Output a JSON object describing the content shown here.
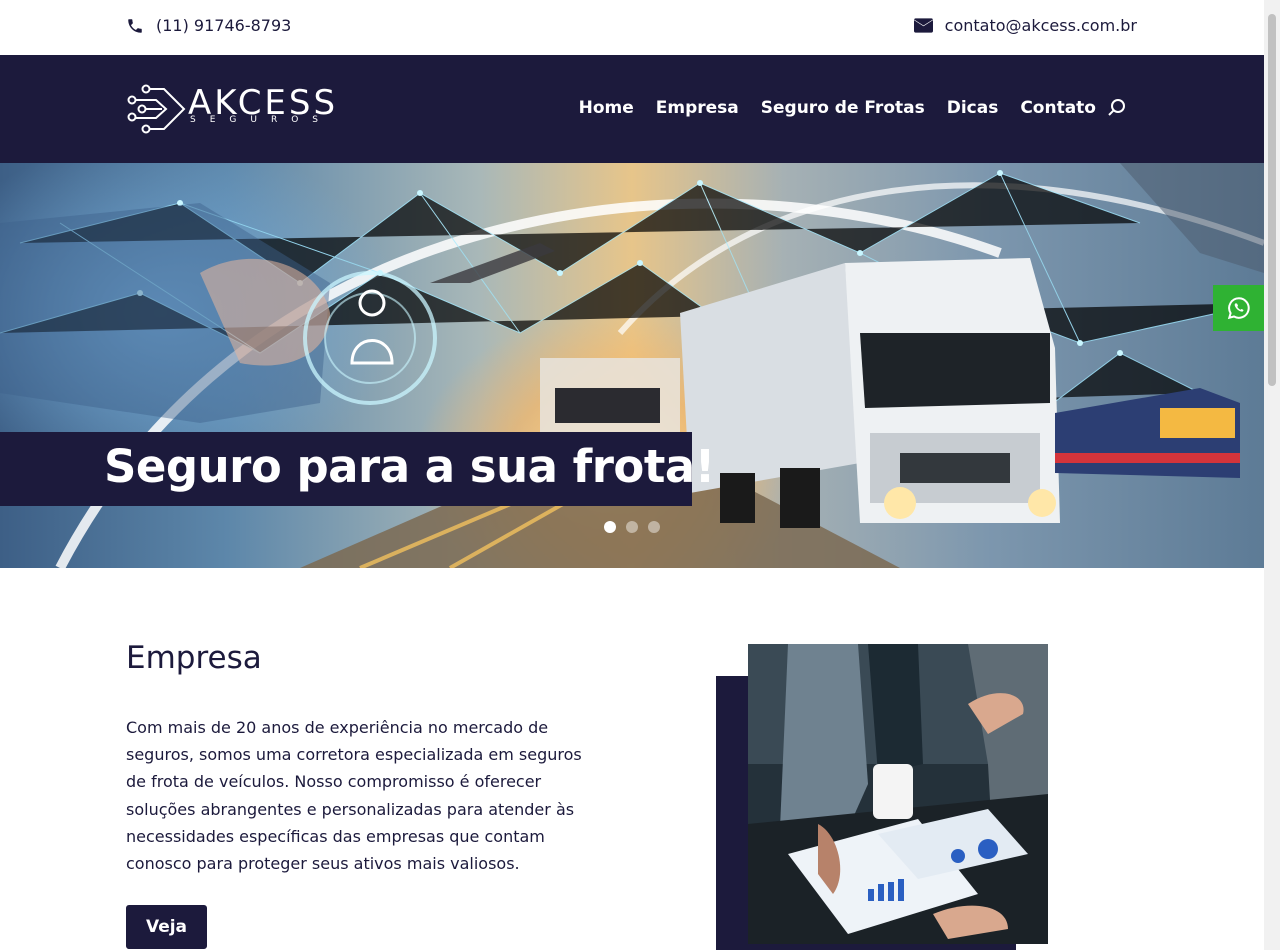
{
  "topbar": {
    "phone": "(11) 91746-8793",
    "email": "contato@akcess.com.br",
    "phone_icon": "phone-icon",
    "email_icon": "envelope-icon"
  },
  "header": {
    "logo_text": "AKCESS",
    "logo_subtext": "SEGUROS",
    "nav": {
      "home": "Home",
      "empresa": "Empresa",
      "seguro_frotas": "Seguro de Frotas",
      "dicas": "Dicas",
      "contato": "Contato"
    },
    "search_icon": "search-icon"
  },
  "hero": {
    "title": "Seguro para a sua frota!",
    "slides": 3,
    "active_slide": 1
  },
  "floating": {
    "whatsapp_icon": "whatsapp-icon"
  },
  "empresa": {
    "title": "Empresa",
    "text": "Com mais de 20 anos de experiência no mercado de seguros, somos uma corretora especializada em seguros de frota de veículos. Nosso compromisso é oferecer soluções abrangentes e personalizadas para atender às necessidades específicas das empresas que contam conosco para proteger seus ativos mais valiosos.",
    "button": "Veja"
  },
  "colors": {
    "navy": "#1c1a3c",
    "whatsapp_green": "#2fb233",
    "white": "#ffffff"
  }
}
